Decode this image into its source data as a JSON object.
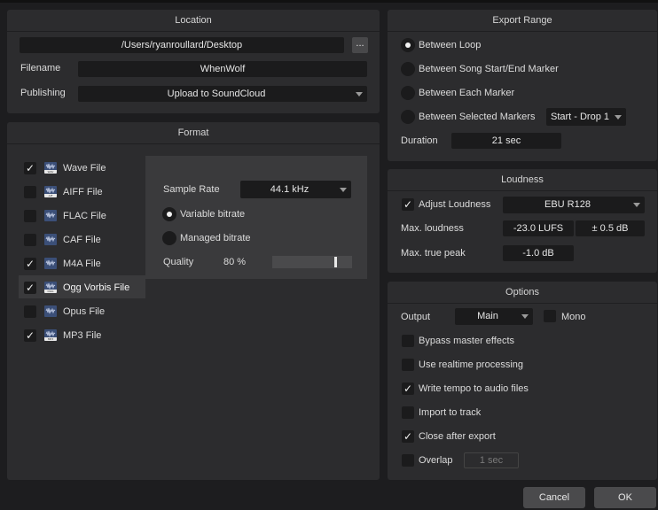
{
  "location": {
    "title": "Location",
    "path": "/Users/ryanroullard/Desktop",
    "browse_label": "...",
    "filename_label": "Filename",
    "filename_value": "WhenWolf",
    "publishing_label": "Publishing",
    "publishing_value": "Upload to SoundCloud"
  },
  "format": {
    "title": "Format",
    "items": [
      {
        "label": "Wave File",
        "checked": true,
        "tag": "WAV"
      },
      {
        "label": "AIFF File",
        "checked": false,
        "tag": "AIF"
      },
      {
        "label": "FLAC File",
        "checked": false,
        "tag": ""
      },
      {
        "label": "CAF File",
        "checked": false,
        "tag": ""
      },
      {
        "label": "M4A File",
        "checked": true,
        "tag": ""
      },
      {
        "label": "Ogg Vorbis File",
        "checked": true,
        "tag": "OGG",
        "selected": true
      },
      {
        "label": "Opus File",
        "checked": false,
        "tag": ""
      },
      {
        "label": "MP3 File",
        "checked": true,
        "tag": "MP3"
      }
    ],
    "check_glyph": "✓",
    "sample_rate_label": "Sample Rate",
    "sample_rate_value": "44.1 kHz",
    "variable_bitrate_label": "Variable bitrate",
    "managed_bitrate_label": "Managed bitrate",
    "quality_label": "Quality",
    "quality_value": "80 %",
    "quality_fraction": 0.8
  },
  "export_range": {
    "title": "Export Range",
    "options": [
      {
        "label": "Between Loop",
        "selected": true
      },
      {
        "label": "Between Song Start/End Marker",
        "selected": false
      },
      {
        "label": "Between Each Marker",
        "selected": false
      },
      {
        "label": "Between Selected Markers",
        "selected": false
      }
    ],
    "markers_value": "Start - Drop 1",
    "duration_label": "Duration",
    "duration_value": "21 sec"
  },
  "loudness": {
    "title": "Loudness",
    "adjust_label": "Adjust Loudness",
    "adjust_checked": true,
    "standard_value": "EBU R128",
    "max_loudness_label": "Max. loudness",
    "max_loudness_value": "-23.0 LUFS",
    "tolerance_value": "± 0.5 dB",
    "max_true_peak_label": "Max. true peak",
    "max_true_peak_value": "-1.0 dB"
  },
  "options": {
    "title": "Options",
    "output_label": "Output",
    "output_value": "Main",
    "mono_label": "Mono",
    "bypass_label": "Bypass master effects",
    "realtime_label": "Use realtime processing",
    "write_tempo_label": "Write tempo to audio files",
    "import_label": "Import to track",
    "close_after_label": "Close after export",
    "overlap_label": "Overlap",
    "overlap_value": "1 sec"
  },
  "buttons": {
    "cancel": "Cancel",
    "ok": "OK"
  }
}
